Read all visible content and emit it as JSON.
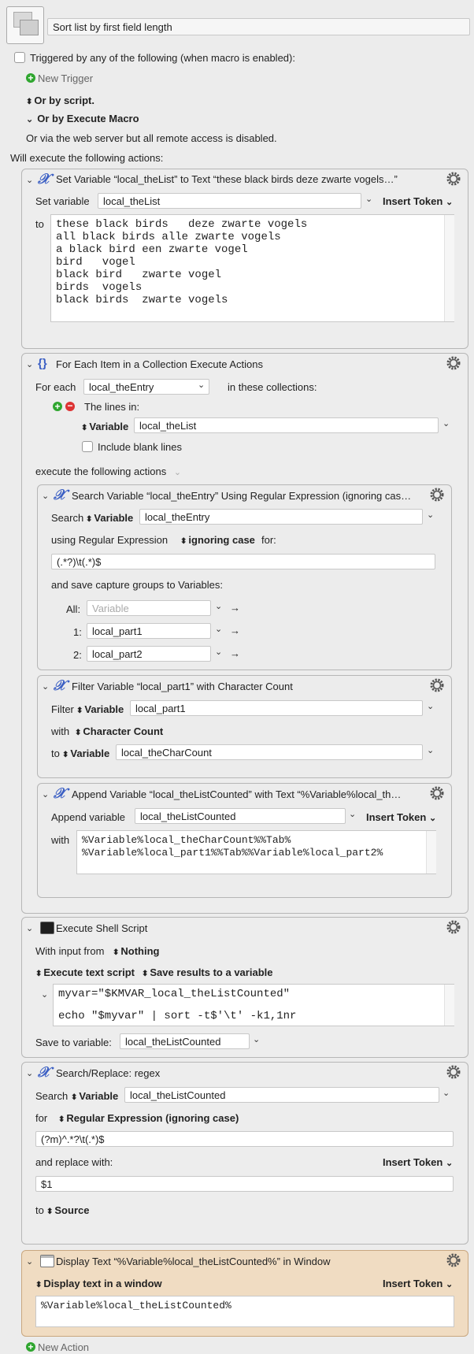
{
  "macro": {
    "name": "Sort list by first field length",
    "trigger_checkbox_label": "Triggered by any of the following (when macro is enabled):",
    "new_trigger": "New Trigger",
    "or_by_script": "Or by script.",
    "or_by_execute_macro": "Or by Execute Macro",
    "web_server_note": "Or via the web server but all remote access is disabled.",
    "will_execute": "Will execute the following actions:",
    "new_action": "New Action"
  },
  "common": {
    "insert_token": "Insert Token",
    "variable": "Variable"
  },
  "set_variable": {
    "title": "Set Variable “local_theList” to Text “these black birds   deze zwarte vogels…”",
    "set_variable_label": "Set variable",
    "variable_name": "local_theList",
    "to_label": "to",
    "text": "these black birds   deze zwarte vogels\nall black birds alle zwarte vogels\na black bird een zwarte vogel\nbird   vogel\nblack bird   zwarte vogel\nbirds  vogels\nblack birds  zwarte vogels"
  },
  "for_each": {
    "title": "For Each Item in a Collection Execute Actions",
    "for_each_label": "For each",
    "variable_name": "local_theEntry",
    "in_collections": "in these collections:",
    "lines_in": "The lines in:",
    "source_type": "Variable",
    "source_variable": "local_theList",
    "include_blank": "Include blank lines",
    "execute_label": "execute the following actions"
  },
  "search_variable": {
    "title": "Search Variable “local_theEntry” Using Regular Expression (ignoring cas…",
    "search_label": "Search",
    "source_type": "Variable",
    "source_variable": "local_theEntry",
    "using_label": "using Regular Expression",
    "case_mode": "ignoring case",
    "for_label": "for:",
    "regex": "(.*?)\\t(.*)$",
    "save_label": "and save capture groups to Variables:",
    "groups": [
      {
        "label": "All:",
        "value": "",
        "placeholder": "Variable"
      },
      {
        "label": "1:",
        "value": "local_part1",
        "placeholder": ""
      },
      {
        "label": "2:",
        "value": "local_part2",
        "placeholder": ""
      }
    ]
  },
  "filter_variable": {
    "title": "Filter Variable “local_part1” with Character Count",
    "filter_label": "Filter",
    "source_type": "Variable",
    "source_variable": "local_part1",
    "with_label": "with",
    "filter_type": "Character Count",
    "to_label": "to",
    "dest_type": "Variable",
    "dest_variable": "local_theCharCount"
  },
  "append_variable": {
    "title": "Append Variable “local_theListCounted” with Text “%Variable%local_th…",
    "append_label": "Append variable",
    "variable_name": "local_theListCounted",
    "with_label": "with",
    "text": "%Variable%local_theCharCount%%Tab%\n%Variable%local_part1%%Tab%%Variable%local_part2%"
  },
  "shell_script": {
    "title": "Execute Shell Script",
    "input_label": "With input from",
    "input_source": "Nothing",
    "mode": "Execute text script",
    "save_mode": "Save results to a variable",
    "script": "myvar=\"$KMVAR_local_theListCounted\"\n\necho \"$myvar\" | sort -t$'\\t' -k1,1nr",
    "save_to_label": "Save to variable:",
    "save_to_variable": "local_theListCounted"
  },
  "search_replace": {
    "title": "Search/Replace: regex",
    "search_label": "Search",
    "source_type": "Variable",
    "source_variable": "local_theListCounted",
    "for_label": "for",
    "mode": "Regular Expression (ignoring case)",
    "pattern": "(?m)^.*?\\t(.*)$",
    "replace_label": "and replace with:",
    "replacement": "$1",
    "to_label": "to",
    "to_value": "Source"
  },
  "display_text": {
    "title": "Display Text “%Variable%local_theListCounted%” in Window",
    "mode": "Display text in a window",
    "text": "%Variable%local_theListCounted%"
  },
  "colors": {
    "accent_blue": "#3b5fc4",
    "plus_green": "#2fa62f",
    "minus_red": "#d33333",
    "display_panel_bg": "#f0dcc2"
  }
}
